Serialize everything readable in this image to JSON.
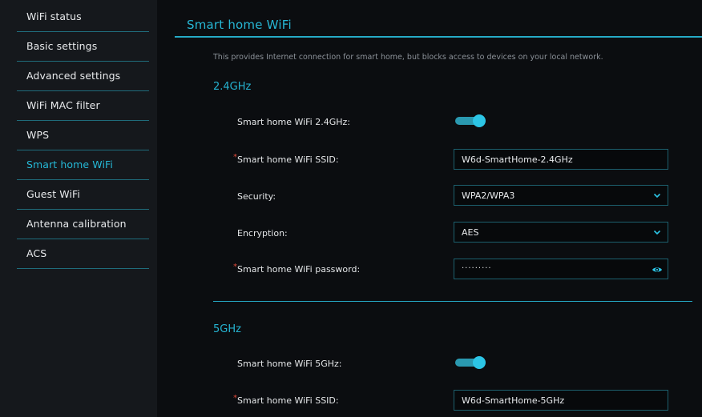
{
  "sidebar": {
    "items": [
      {
        "label": "WiFi status"
      },
      {
        "label": "Basic settings"
      },
      {
        "label": "Advanced settings"
      },
      {
        "label": "WiFi MAC filter"
      },
      {
        "label": "WPS"
      },
      {
        "label": "Smart home WiFi",
        "active": true
      },
      {
        "label": "Guest WiFi"
      },
      {
        "label": "Antenna calibration"
      },
      {
        "label": "ACS"
      }
    ]
  },
  "page": {
    "title": "Smart home WiFi",
    "description": "This provides Internet connection for smart home, but blocks access to devices on your local network."
  },
  "band24": {
    "heading": "2.4GHz",
    "toggle_label": "Smart home WiFi 2.4GHz:",
    "toggle_on": true,
    "ssid_label": "Smart home WiFi SSID:",
    "ssid_value": "W6d-SmartHome-2.4GHz",
    "security_label": "Security:",
    "security_value": "WPA2/WPA3",
    "encryption_label": "Encryption:",
    "encryption_value": "AES",
    "password_label": "Smart home WiFi password:",
    "password_value": "·········"
  },
  "band5": {
    "heading": "5GHz",
    "toggle_label": "Smart home WiFi 5GHz:",
    "toggle_on": true,
    "ssid_label": "Smart home WiFi SSID:",
    "ssid_value": "W6d-SmartHome-5GHz"
  },
  "icons": {
    "dropdown": "chevron-down-icon",
    "password_visibility": "eye-icon"
  },
  "colors": {
    "accent": "#27b7d5",
    "required": "#e04a3a",
    "background": "#0b0d10",
    "sidebar_bg": "#15181c"
  }
}
